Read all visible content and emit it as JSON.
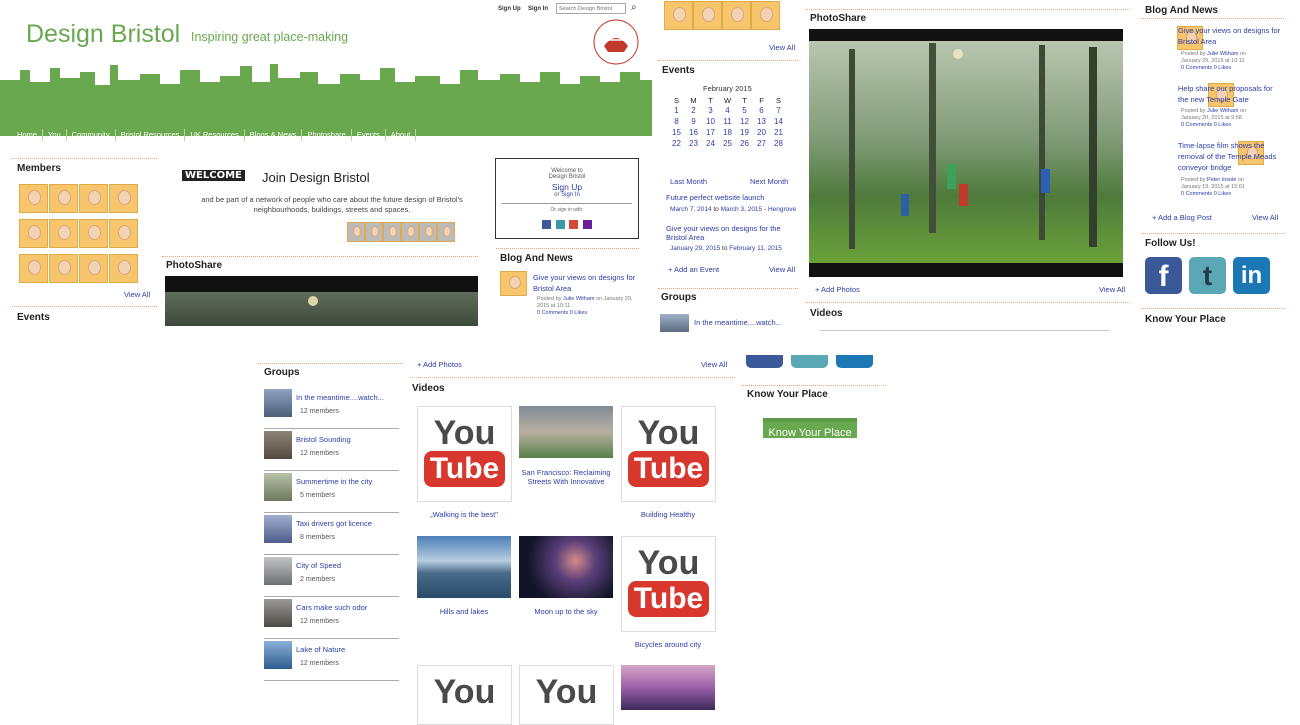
{
  "topbar": {
    "signup": "Sign Up",
    "signin": "Sign In",
    "search_placeholder": "Search Design Bristol"
  },
  "site": {
    "title": "Design Bristol",
    "tagline": "Inspiring great place-making",
    "council": "BRISTOL CITY COUNCIL"
  },
  "nav": [
    "Home",
    "You",
    "Community",
    "Bristol Resources",
    "UK Resources",
    "Blogs & News",
    "Photoshare",
    "Events",
    "About"
  ],
  "members": {
    "heading": "Members",
    "view_all": "View All"
  },
  "events_left": {
    "heading": "Events"
  },
  "welcome": {
    "logo": "WELCOME",
    "title": "Join Design Bristol",
    "text": "and be part of a network of people who care about the future design of Bristol's neighbourhoods, buildings, streets and spaces."
  },
  "signbox": {
    "welcome": "Welcome to",
    "site": "Design Bristol",
    "signup": "Sign Up",
    "or": "or",
    "signin": "Sign In",
    "signin_with": "Or sign in with:"
  },
  "photoshare": {
    "heading": "PhotoShare",
    "add": "+ Add Photos",
    "view_all": "View All"
  },
  "blog_small": {
    "heading": "Blog And News",
    "title": "Give your views on designs for Bristol Area",
    "posted": "Posted by",
    "author": "Julie Witham",
    "on": "on",
    "date": "January 29, 2015 at 10:11",
    "comments": "0 Comments",
    "likes": "0 Likes"
  },
  "col3": {
    "view_all": "View All",
    "events_heading": "Events",
    "month": "February 2015",
    "days": [
      "S",
      "M",
      "T",
      "W",
      "T",
      "F",
      "S"
    ],
    "weeks": [
      [
        "1",
        "2",
        "3",
        "4",
        "5",
        "6",
        "7"
      ],
      [
        "8",
        "9",
        "10",
        "11",
        "12",
        "13",
        "14"
      ],
      [
        "15",
        "16",
        "17",
        "18",
        "19",
        "20",
        "21"
      ],
      [
        "22",
        "23",
        "24",
        "25",
        "26",
        "27",
        "28"
      ]
    ],
    "last_month": "Last Month",
    "next_month": "Next Month",
    "ev1": "Future perfect website launch",
    "ev1_from": "March 7, 2014",
    "ev1_to_word": "to",
    "ev1_to": "March 3, 2015",
    "ev1_dash": " - ",
    "ev1_loc": "Hengrove",
    "ev2": "Give your views on designs for the Bristol Area",
    "ev2_from": "January 29, 2015",
    "ev2_to_word": "to",
    "ev2_to": "February 11, 2015",
    "add_event": "+ Add an Event",
    "ev_view_all": "View All",
    "groups": "Groups",
    "group_first": "In the meantime....watch..."
  },
  "photo_big": {
    "heading": "PhotoShare",
    "add": "+ Add Photos",
    "view_all": "View All",
    "videos": "Videos"
  },
  "blog_big": {
    "heading": "Blog And News",
    "posts": [
      {
        "title": "Give your views on designs for Bristol Area",
        "posted": "Posted by",
        "author": "Julie Witham",
        "on": "on",
        "date": "January 29, 2015 at 10:11",
        "comments": "0 Comments",
        "likes": "0 Likes"
      },
      {
        "title": "Help share our proposals for the new Temple Gate",
        "posted": "Posted by",
        "author": "Julie Witham",
        "on": "on",
        "date": "January 20, 2015 at 9:58",
        "comments": "0 Comments",
        "likes": "0 Likes"
      },
      {
        "title": "Time-lapse film shows the removal of the Temple Meads conveyor bridge",
        "posted": "Posted by",
        "author": "Peter Insole",
        "on": "on",
        "date": "January 19, 2015 at 15:01",
        "comments": "0 Comments",
        "likes": "0 Likes"
      }
    ],
    "add": "+ Add a Blog Post",
    "view_all": "View All",
    "follow": "Follow Us!",
    "know": "Know Your Place"
  },
  "groups": {
    "heading": "Groups",
    "items": [
      {
        "name": "In the meantime....watch...",
        "members": "12 members"
      },
      {
        "name": "Bristol Sounding",
        "members": "12 members"
      },
      {
        "name": "Summertime in the city",
        "members": "5 members"
      },
      {
        "name": "Taxi drivers got licence",
        "members": "8 members"
      },
      {
        "name": "City of Speed",
        "members": "2 members"
      },
      {
        "name": "Cars make such odor",
        "members": "12 members"
      },
      {
        "name": "Lake of Nature",
        "members": "12 members"
      }
    ]
  },
  "videos": {
    "add": "+ Add Photos",
    "view_all": "View All",
    "heading": "Videos",
    "you": "You",
    "tube": "Tube",
    "t1": "„Walking is the best\"",
    "t2": "San Francisco: Reclaiming Streets With Innovative",
    "t3": "Building Healthy",
    "t4": "Hills and lakes",
    "t5": "Moon up to the sky",
    "t6": "Bicycles around city"
  },
  "know": {
    "heading": "Know Your Place",
    "button": "Know Your Place"
  },
  "colors": {
    "green": "#6aa84f",
    "link": "#2b3ea6",
    "accent_line": "#e8a878"
  }
}
